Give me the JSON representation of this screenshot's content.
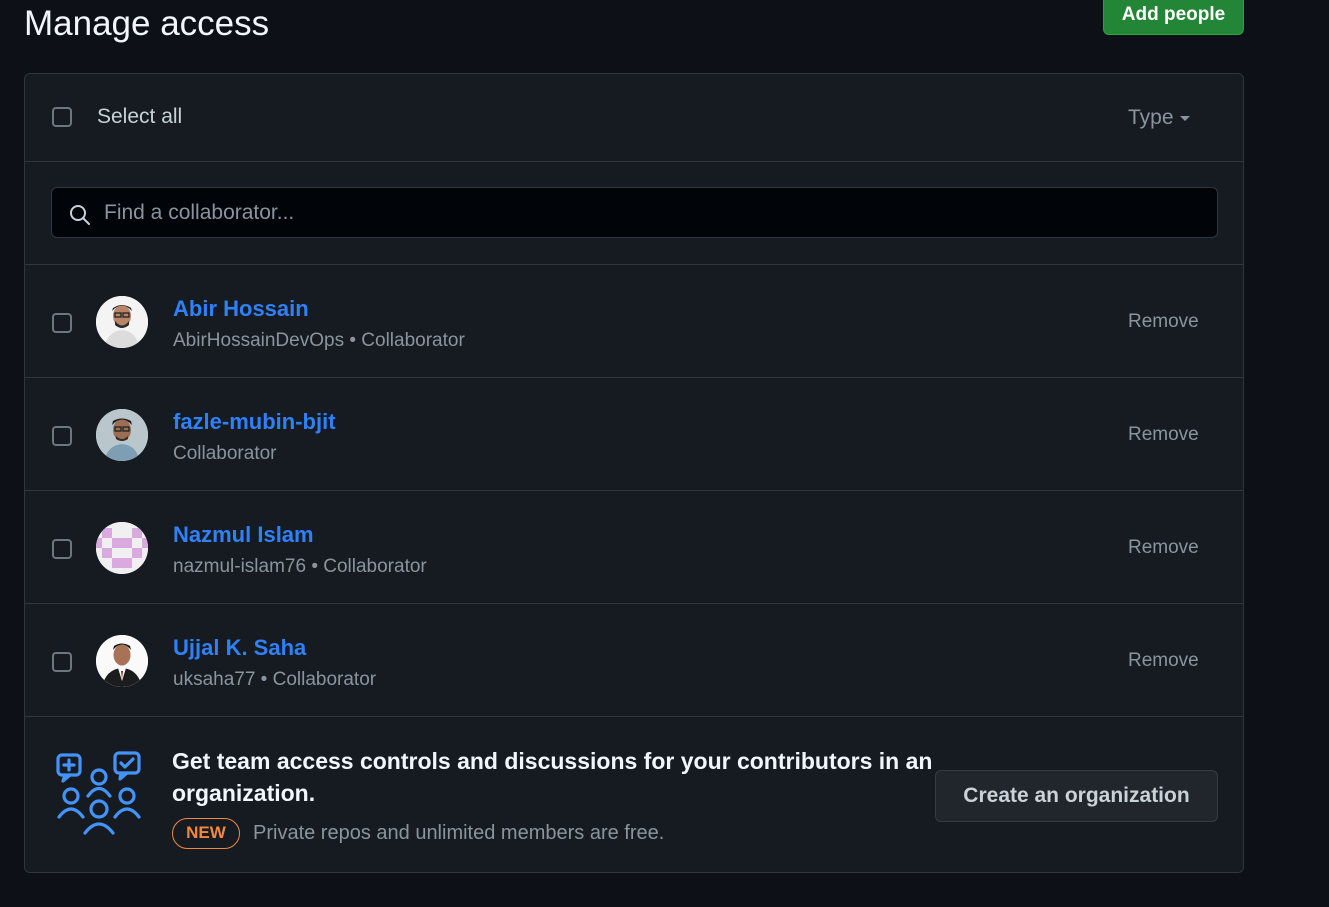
{
  "header": {
    "title": "Manage access",
    "add_people_label": "Add people"
  },
  "toolbar": {
    "select_all_label": "Select all",
    "type_label": "Type"
  },
  "search": {
    "placeholder": "Find a collaborator..."
  },
  "collaborators": [
    {
      "name": "Abir Hossain",
      "meta": "AbirHossainDevOps • Collaborator",
      "remove_label": "Remove"
    },
    {
      "name": "fazle-mubin-bjit",
      "meta": "Collaborator",
      "remove_label": "Remove"
    },
    {
      "name": "Nazmul Islam",
      "meta": "nazmul-islam76 • Collaborator",
      "remove_label": "Remove"
    },
    {
      "name": "Ujjal K. Saha",
      "meta": "uksaha77 • Collaborator",
      "remove_label": "Remove"
    }
  ],
  "promo": {
    "title": "Get team access controls and discussions for your contributors in an organization.",
    "badge": "NEW",
    "subtitle": "Private repos and unlimited members are free.",
    "button_label": "Create an organization"
  },
  "colors": {
    "background": "#0d1117",
    "panel": "#161b22",
    "border": "#30363d",
    "link": "#2f81f7",
    "primary_button": "#238636",
    "badge": "#f0883e",
    "icon_accent": "#4493f8"
  },
  "icons": {
    "search": "search-icon",
    "caret": "caret-down-icon",
    "promo": "people-discussion-icon"
  }
}
